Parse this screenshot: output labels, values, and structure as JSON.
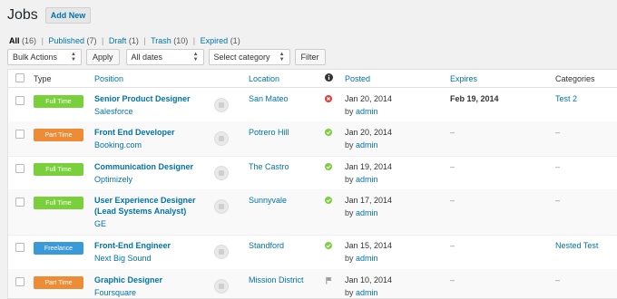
{
  "header": {
    "title": "Jobs",
    "add_new": "Add New"
  },
  "views": [
    {
      "label": "All",
      "count": "(16)"
    },
    {
      "label": "Published",
      "count": "(7)"
    },
    {
      "label": "Draft",
      "count": "(1)"
    },
    {
      "label": "Trash",
      "count": "(10)"
    },
    {
      "label": "Expired",
      "count": "(1)"
    }
  ],
  "separator": "|",
  "filters": {
    "bulk_actions": "Bulk Actions",
    "apply": "Apply",
    "dates": "All dates",
    "category": "Select category",
    "filter": "Filter"
  },
  "columns": {
    "type": "Type",
    "position": "Position",
    "location": "Location",
    "status_icon": "info-icon",
    "posted": "Posted",
    "expires": "Expires",
    "categories": "Categories"
  },
  "colors": {
    "full_time": "#7ad03a",
    "part_time": "#ee8b35",
    "freelance": "#3a9ad9",
    "approved": "#7ad03a",
    "rejected": "#dd3d36",
    "link": "#0073aa"
  },
  "rows": [
    {
      "type": "Full Time",
      "type_key": "full_time",
      "title": "Senior Product Designer",
      "title2": "",
      "company": "Salesforce",
      "location": "San Mateo",
      "status": "rejected-icon",
      "date": "Jan 20, 2014",
      "by": "by",
      "author": "admin",
      "expires": "Feb 19, 2014",
      "category": "Test 2"
    },
    {
      "type": "Part Time",
      "type_key": "part_time",
      "title": "Front End Developer",
      "title2": "",
      "company": "Booking.com",
      "location": "Potrero Hill",
      "status": "check-icon",
      "date": "Jan 20, 2014",
      "by": "by",
      "author": "admin",
      "expires": "–",
      "category": "–"
    },
    {
      "type": "Full Time",
      "type_key": "full_time",
      "title": "Communication Designer",
      "title2": "",
      "company": "Optimizely",
      "location": "The Castro",
      "status": "check-icon",
      "date": "Jan 19, 2014",
      "by": "by",
      "author": "admin",
      "expires": "–",
      "category": "–"
    },
    {
      "type": "Full Time",
      "type_key": "full_time",
      "title": "User Experience Designer",
      "title2": "(Lead Systems Analyst)",
      "company": "GE",
      "location": "Sunnyvale",
      "status": "check-icon",
      "date": "Jan 17, 2014",
      "by": "by",
      "author": "admin",
      "expires": "–",
      "category": "–"
    },
    {
      "type": "Freelance",
      "type_key": "freelance",
      "title": "Front-End Engineer",
      "title2": "",
      "company": "Next Big Sound",
      "location": "Standford",
      "status": "check-icon",
      "date": "Jan 15, 2014",
      "by": "by",
      "author": "admin",
      "expires": "–",
      "category": "Nested Test"
    },
    {
      "type": "Part Time",
      "type_key": "part_time",
      "title": "Graphic Designer",
      "title2": "",
      "company": "Foursquare",
      "location": "Mission District",
      "status": "flag-icon",
      "date": "Jan 10, 2014",
      "by": "by",
      "author": "admin",
      "expires": "–",
      "category": "–"
    }
  ]
}
